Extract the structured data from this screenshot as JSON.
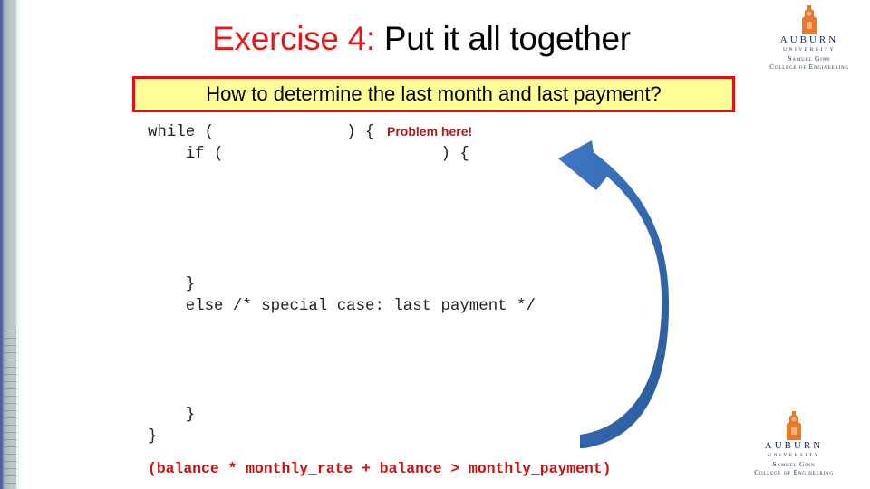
{
  "slide": {
    "title_accent": "Exercise 4:",
    "title_rest": " Put it all together",
    "question": "How to determine the last month and last payment?",
    "annotation": "Problem here!",
    "code_lines": [
      "while (              ) {",
      "    if (                       ) {",
      "    }",
      "    else /* special case: last payment */",
      "    }",
      "}"
    ],
    "condition": "(balance * monthly_rate + balance > monthly_payment)",
    "colors": {
      "accent_red": "#e31a1a",
      "box_fill": "#ffff99",
      "box_border": "#e01010",
      "arrow_blue": "#3a6fb8",
      "logo_orange": "#e8792a",
      "logo_navy": "#1a2a5a"
    }
  },
  "logos": [
    {
      "name": "AUBURN",
      "subtitle": "UNIVERSITY",
      "college_line1": "Samuel Ginn",
      "college_line2": "College of Engineering"
    },
    {
      "name": "AUBURN",
      "subtitle": "UNIVERSITY",
      "college_line1": "Samuel Ginn",
      "college_line2": "College of Engineering"
    }
  ]
}
